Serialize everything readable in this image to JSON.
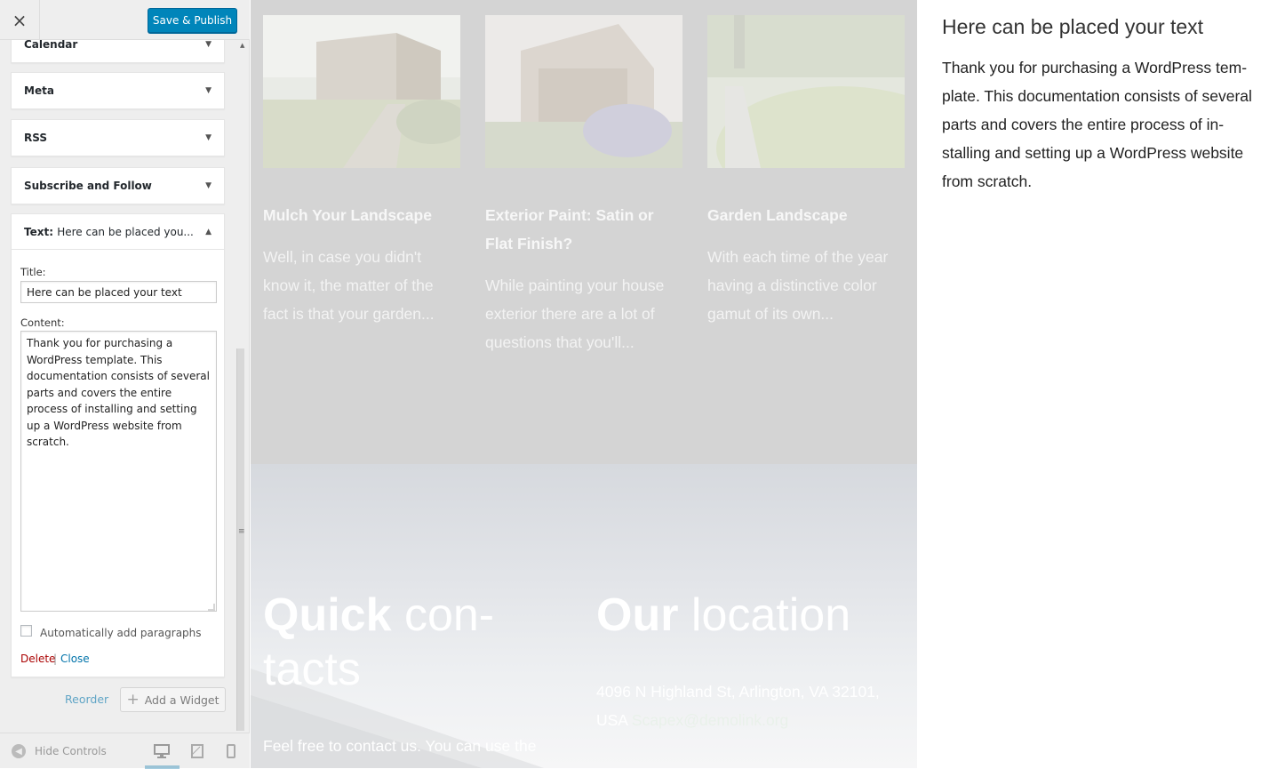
{
  "sidebar": {
    "header": {
      "close_icon": "×",
      "publish_label": "Save & Publish"
    },
    "widgets": [
      {
        "label": "Calendar"
      },
      {
        "label": "Meta"
      },
      {
        "label": "RSS"
      },
      {
        "label": "Subscribe and Follow"
      }
    ],
    "text_widget": {
      "label_prefix": "Text:",
      "label_sub": "Here can be placed you...",
      "title_label": "Title:",
      "title_value": "Here can be placed your text",
      "content_label": "Content:",
      "content_value": "Thank you for purchasing a WordPress template. This documentation consists of several parts and covers the entire process of installing and setting up a WordPress website from scratch.",
      "auto_paragraphs_label": "Automatically add paragraphs",
      "auto_paragraphs_checked": false,
      "delete_label": "Delete",
      "separator": "|",
      "close_label": "Close"
    },
    "reorder_label": "Reorder",
    "add_widget_label": "Add a Widget",
    "footer": {
      "hide_controls_label": "Hide Controls"
    }
  },
  "preview": {
    "posts": [
      {
        "title": "Mulch Your Landscape",
        "excerpt": "Well, in case you didn't know it, the matter of the fact is that your garden..."
      },
      {
        "title": "Exterior Paint: Satin or Flat Finish?",
        "excerpt": "While painting your house exterior there are a lot of questions that you'll..."
      },
      {
        "title": "Garden Landscape",
        "excerpt": "With each time of the year having a distinctive color gamut of its own..."
      }
    ],
    "quick_contacts": {
      "bold": "Quick",
      "rest": " con-tacts",
      "text": "Feel free to contact us. You can use the"
    },
    "location": {
      "bold": "Our",
      "rest": " location",
      "address": "4096 N Highland St, Arlington, VA 32101, USA",
      "email": "Scapex@demolink.org"
    },
    "text_widget": {
      "title": "Here can be placed your text",
      "body": "Thank you for purchasing a WordPress tem-plate. This documentation consists of several parts and covers the entire process of in-stalling and setting up a WordPress website from scratch."
    }
  },
  "colors": {
    "primary": "#0085ba",
    "link": "#0073aa",
    "delete": "#aa0000",
    "sidebar_bg": "#eeeeee"
  }
}
